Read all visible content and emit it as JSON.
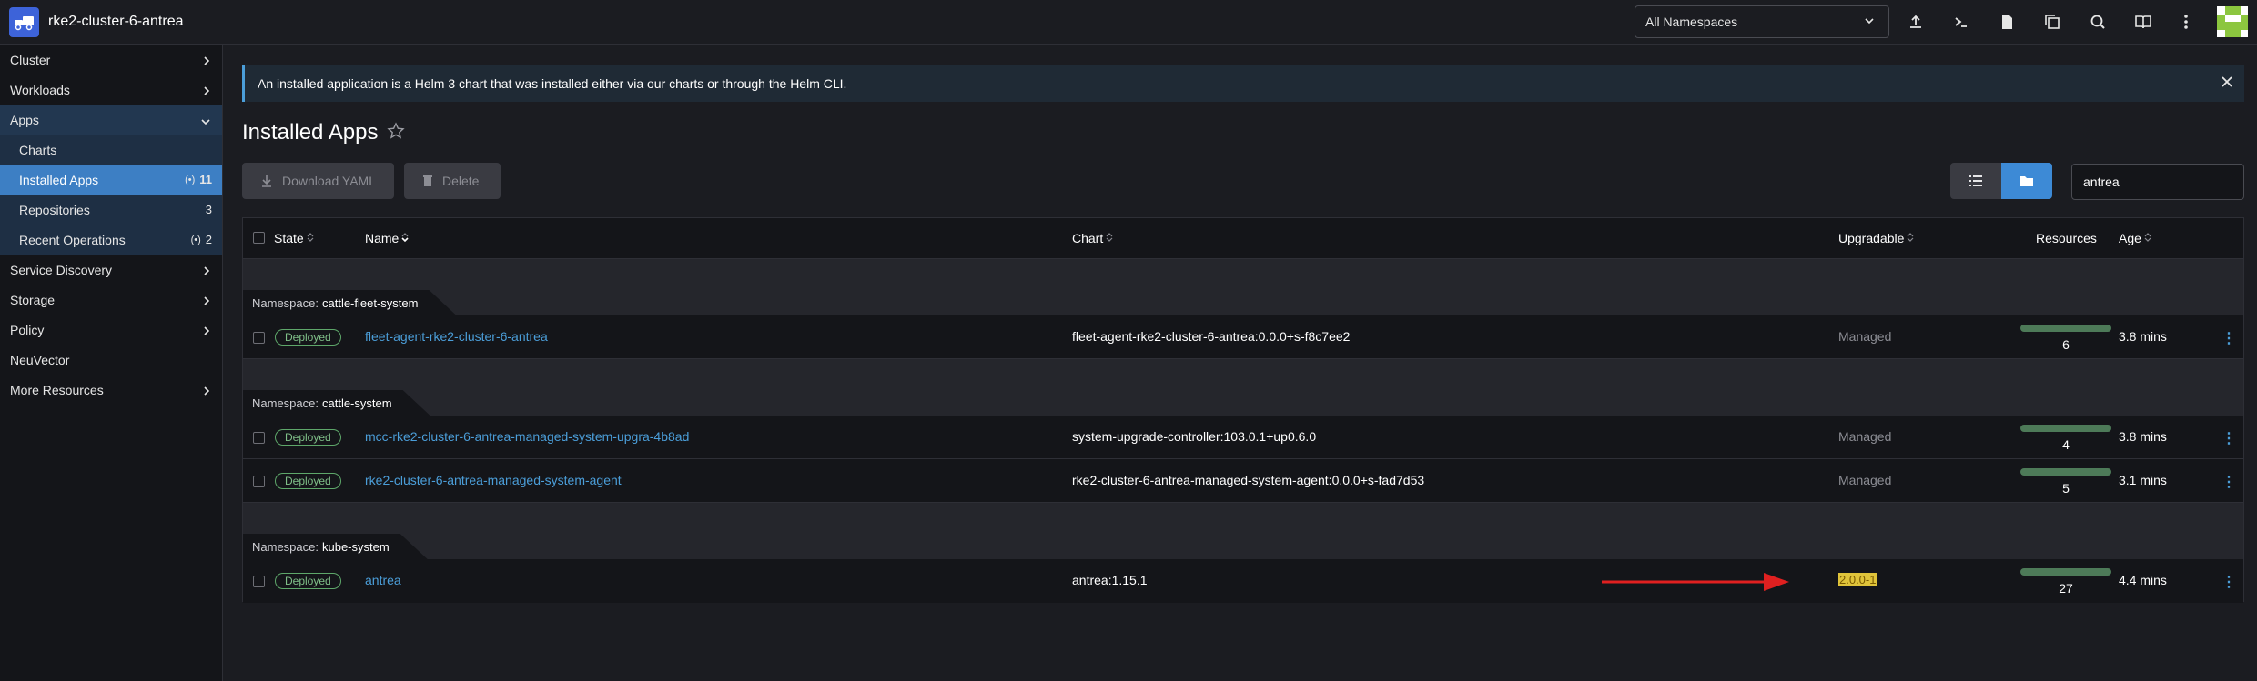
{
  "header": {
    "cluster_name": "rke2-cluster-6-antrea",
    "namespace_select": "All Namespaces",
    "icons": [
      "upload-icon",
      "terminal-icon",
      "file-icon",
      "copy-icon",
      "search-icon",
      "book-icon",
      "more-vertical-icon"
    ]
  },
  "sidebar": {
    "items": [
      {
        "label": "Cluster"
      },
      {
        "label": "Workloads"
      },
      {
        "label": "Apps"
      },
      {
        "label": "Charts"
      },
      {
        "label": "Installed Apps",
        "count": "11"
      },
      {
        "label": "Repositories",
        "count": "3"
      },
      {
        "label": "Recent Operations",
        "count": "2"
      },
      {
        "label": "Service Discovery"
      },
      {
        "label": "Storage"
      },
      {
        "label": "Policy"
      },
      {
        "label": "NeuVector"
      },
      {
        "label": "More Resources"
      }
    ]
  },
  "banner": {
    "text": "An installed application is a Helm 3 chart that was installed either via our charts or through the Helm CLI."
  },
  "page": {
    "title": "Installed Apps",
    "download_label": "Download YAML",
    "delete_label": "Delete",
    "search_value": "antrea"
  },
  "table": {
    "headers": {
      "state": "State",
      "name": "Name",
      "chart": "Chart",
      "upgradable": "Upgradable",
      "resources": "Resources",
      "age": "Age"
    },
    "namespace_label": "Namespace:",
    "groups": [
      {
        "namespace": "cattle-fleet-system",
        "rows": [
          {
            "state": "Deployed",
            "name": "fleet-agent-rke2-cluster-6-antrea",
            "chart": "fleet-agent-rke2-cluster-6-antrea:0.0.0+s-f8c7ee2",
            "upgradable": "Managed",
            "resources": "6",
            "age": "3.8 mins"
          }
        ]
      },
      {
        "namespace": "cattle-system",
        "rows": [
          {
            "state": "Deployed",
            "name": "mcc-rke2-cluster-6-antrea-managed-system-upgra-4b8ad",
            "chart": "system-upgrade-controller:103.0.1+up0.6.0",
            "upgradable": "Managed",
            "resources": "4",
            "age": "3.8 mins"
          },
          {
            "state": "Deployed",
            "name": "rke2-cluster-6-antrea-managed-system-agent",
            "chart": "rke2-cluster-6-antrea-managed-system-agent:0.0.0+s-fad7d53",
            "upgradable": "Managed",
            "resources": "5",
            "age": "3.1 mins"
          }
        ]
      },
      {
        "namespace": "kube-system",
        "rows": [
          {
            "state": "Deployed",
            "name": "antrea",
            "chart": "antrea:1.15.1",
            "upgradable": "2.0.0-1",
            "resources": "27",
            "age": "4.4 mins"
          }
        ]
      }
    ]
  },
  "colors": {
    "accent": "#3d7fc4",
    "link": "#4b9ed9",
    "deployed": "#5ea76a",
    "highlight": "#e0c43a",
    "arrow": "#e02020"
  }
}
